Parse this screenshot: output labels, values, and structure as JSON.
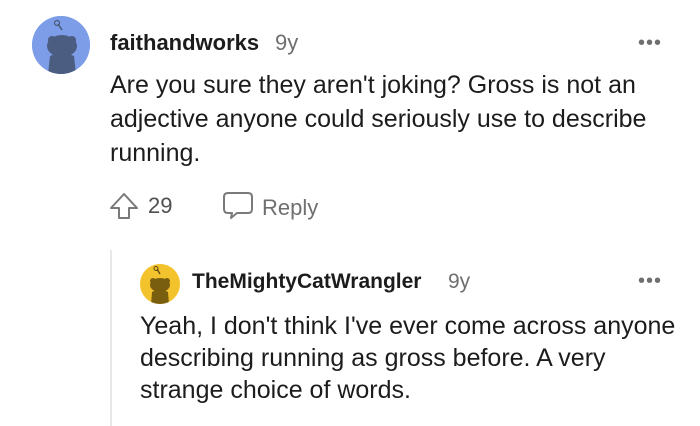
{
  "comments": [
    {
      "username": "faithandworks",
      "age": "9y",
      "more": "•••",
      "body": "Are you sure they aren't joking? Gross is not an adjective anyone could seriously use to describe running.",
      "score": "29",
      "reply_label": "Reply",
      "avatar_color": "#7d9de8"
    },
    {
      "username": "TheMightyCatWrangler",
      "age": "9y",
      "more": "•••",
      "body": "Yeah, I don't think I've ever come across anyone describing running as gross before. A very strange choice of words.",
      "avatar_color": "#f3c32d"
    }
  ]
}
